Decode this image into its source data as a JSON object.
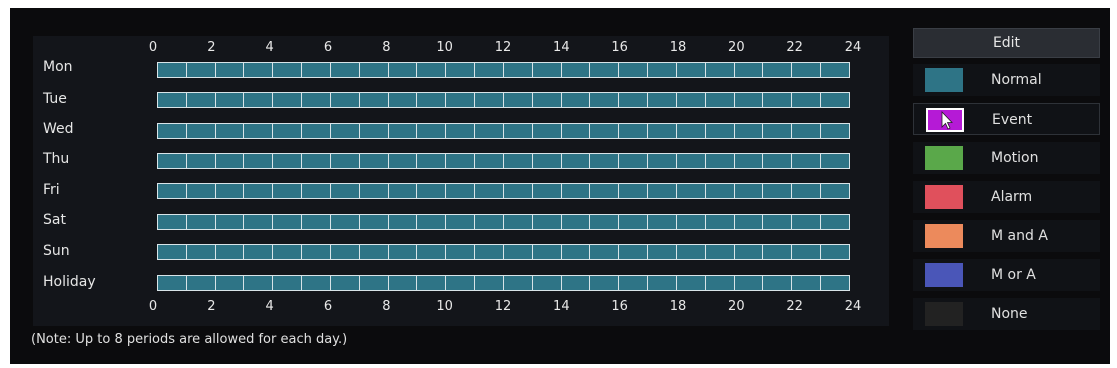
{
  "hours_top": [
    "0",
    "2",
    "4",
    "6",
    "8",
    "10",
    "12",
    "14",
    "16",
    "18",
    "20",
    "22",
    "24"
  ],
  "hours_bottom": [
    "0",
    "2",
    "4",
    "6",
    "8",
    "10",
    "12",
    "14",
    "16",
    "18",
    "20",
    "22",
    "24"
  ],
  "days": [
    "Mon",
    "Tue",
    "Wed",
    "Thu",
    "Fri",
    "Sat",
    "Sun",
    "Holiday"
  ],
  "note": "(Note: Up to 8 periods are allowed for each day.)",
  "legend": {
    "edit_label": "Edit",
    "items": [
      {
        "label": "Normal",
        "color": "#2e7486"
      },
      {
        "label": "Event",
        "color": "#b51ad6"
      },
      {
        "label": "Motion",
        "color": "#5aa84a"
      },
      {
        "label": "Alarm",
        "color": "#e0505c"
      },
      {
        "label": "M and A",
        "color": "#ec8a5c"
      },
      {
        "label": "M or A",
        "color": "#4a56b8"
      },
      {
        "label": "None",
        "color": "#222222"
      }
    ],
    "selected": "Event"
  },
  "colors": {
    "bar": "#2e7486",
    "grid": "#d8e4e8",
    "background": "#0b0b0d"
  }
}
